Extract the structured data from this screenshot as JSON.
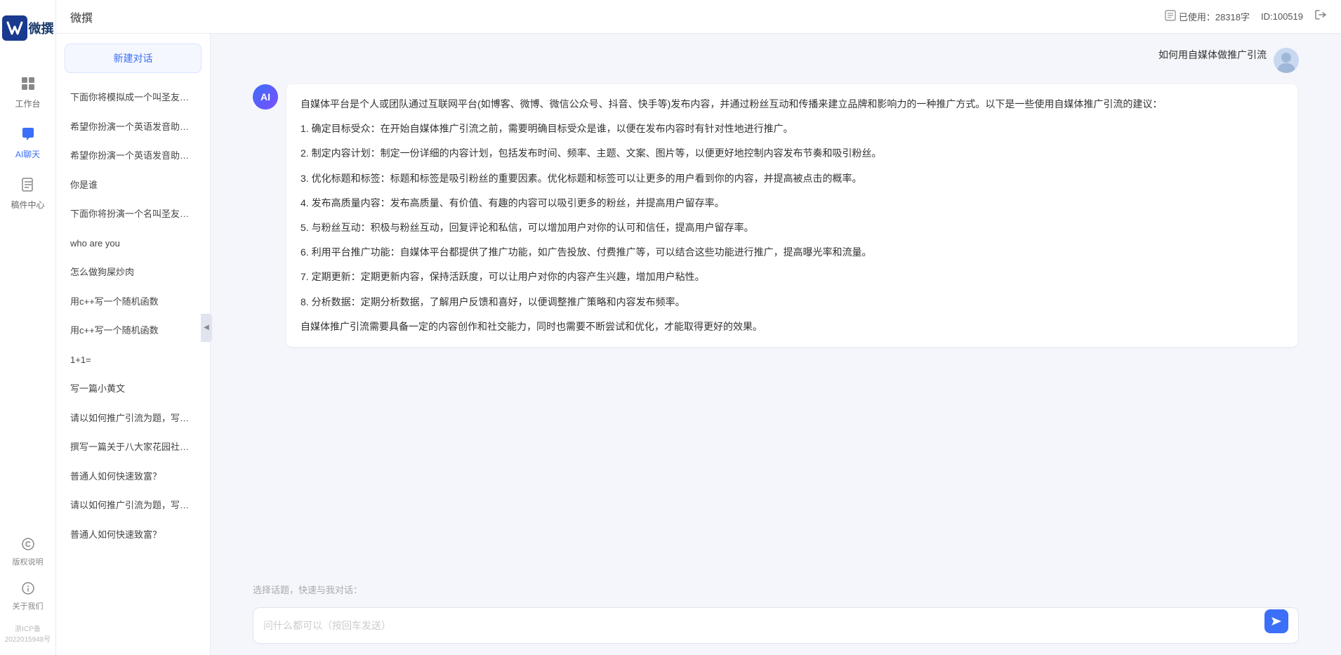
{
  "app": {
    "title": "微撰",
    "logo_text": "微撰",
    "word_count_label": "已使用：28318字",
    "id_label": "ID:100519",
    "icp": "浙ICP备2022015948号"
  },
  "nav": {
    "items": [
      {
        "id": "workbench",
        "label": "工作台",
        "icon": "⊞"
      },
      {
        "id": "ai-chat",
        "label": "AI聊天",
        "icon": "💬",
        "active": true
      },
      {
        "id": "drafts",
        "label": "稿件中心",
        "icon": "📄"
      }
    ],
    "bottom_items": [
      {
        "id": "copyright",
        "label": "版权说明",
        "icon": "©"
      },
      {
        "id": "about",
        "label": "关于我们",
        "icon": "ℹ"
      }
    ]
  },
  "sidebar": {
    "new_chat_label": "新建对话",
    "history_items": [
      "下面你将模拟成一个叫圣友的程序员，我说...",
      "希望你扮演一个英语发音助手，我提供给你...",
      "希望你扮演一个英语发音助手，我提供给你...",
      "你是谁",
      "下面你将扮演一个名叫圣友的医生",
      "who are you",
      "怎么做狗屎炒肉",
      "用c++写一个随机函数",
      "用c++写一个随机函数",
      "1+1=",
      "写一篇小黄文",
      "请以如何推广引流为题，写一篇大纲",
      "撰写一篇关于八大家花园社区一刻钟便民生...",
      "普通人如何快速致富？",
      "请以如何推广引流为题，写一篇大纲",
      "普通人如何快速致富？"
    ]
  },
  "chat": {
    "user_message": "如何用自媒体做推广引流",
    "ai_response": {
      "paragraphs": [
        "自媒体平台是个人或团队通过互联网平台(如博客、微博、微信公众号、抖音、快手等)发布内容，并通过粉丝互动和传播来建立品牌和影响力的一种推广方式。以下是一些使用自媒体推广引流的建议：",
        "1. 确定目标受众：在开始自媒体推广引流之前，需要明确目标受众是谁，以便在发布内容时有针对性地进行推广。",
        "2. 制定内容计划：制定一份详细的内容计划，包括发布时间、频率、主题、文案、图片等，以便更好地控制内容发布节奏和吸引粉丝。",
        "3. 优化标题和标签：标题和标签是吸引粉丝的重要因素。优化标题和标签可以让更多的用户看到你的内容，并提高被点击的概率。",
        "4. 发布高质量内容：发布高质量、有价值、有趣的内容可以吸引更多的粉丝，并提高用户留存率。",
        "5. 与粉丝互动：积极与粉丝互动，回复评论和私信，可以增加用户对你的认可和信任，提高用户留存率。",
        "6. 利用平台推广功能：自媒体平台都提供了推广功能，如广告投放、付费推广等，可以结合这些功能进行推广，提高曝光率和流量。",
        "7. 定期更新：定期更新内容，保持活跃度，可以让用户对你的内容产生兴趣，增加用户粘性。",
        "8. 分析数据：定期分析数据，了解用户反馈和喜好，以便调整推广策略和内容发布频率。",
        "自媒体推广引流需要具备一定的内容创作和社交能力，同时也需要不断尝试和优化，才能取得更好的效果。"
      ]
    },
    "quick_topics_label": "选择话题，快速与我对话：",
    "input_placeholder": "问什么都可以（按回车发送）"
  }
}
